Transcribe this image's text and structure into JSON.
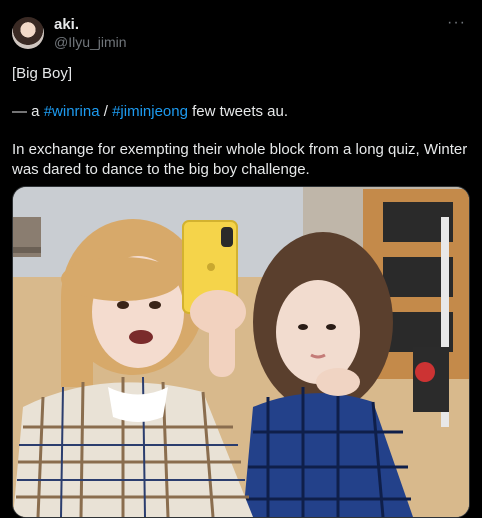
{
  "author": {
    "display_name": "aki.",
    "handle": "@Ilyu_jimin"
  },
  "tweet": {
    "line1": "[Big Boy]",
    "line2_prefix": "— a ",
    "hashtag1": "#winrina",
    "separator": " / ",
    "hashtag2": "#jiminjeong",
    "line2_suffix": " few tweets au.",
    "line3": "In exchange for exempting their whole block from a long quiz, Winter was dared to dance to the big boy challenge."
  },
  "icons": {
    "more": "more-dots-icon"
  },
  "colors": {
    "background": "#000000",
    "text": "#e7e9ea",
    "secondary": "#71767b",
    "link": "#1d9bf0"
  }
}
